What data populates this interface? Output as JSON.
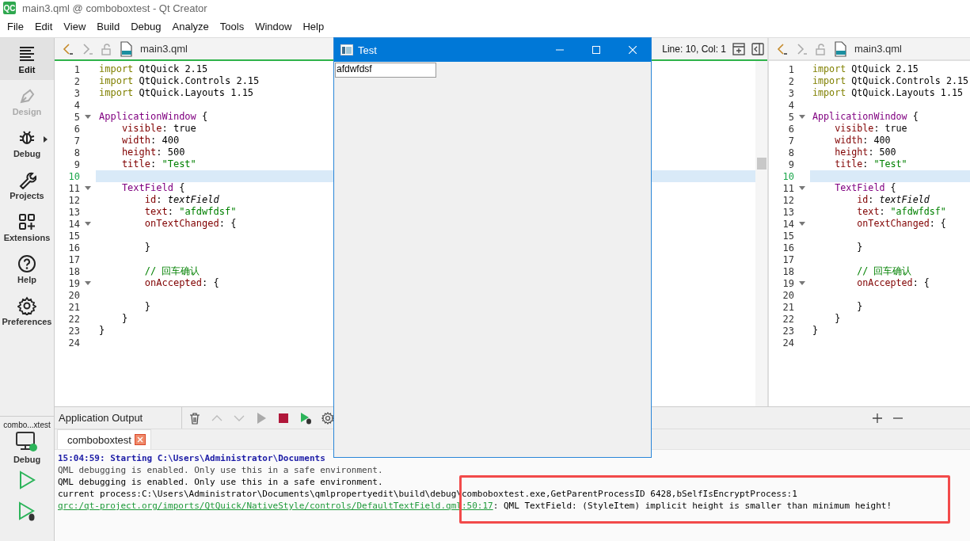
{
  "window": {
    "title": "main3.qml @ comboboxtest - Qt Creator",
    "app_badge": "QC"
  },
  "menu": [
    "File",
    "Edit",
    "View",
    "Build",
    "Debug",
    "Analyze",
    "Tools",
    "Window",
    "Help"
  ],
  "mode_bar": {
    "items": [
      {
        "label": "Edit",
        "kind": "edit",
        "selected": true,
        "disabled": false
      },
      {
        "label": "Design",
        "kind": "design",
        "selected": false,
        "disabled": true
      },
      {
        "label": "Debug",
        "kind": "debug",
        "selected": false,
        "disabled": false
      },
      {
        "label": "Projects",
        "kind": "projects",
        "selected": false,
        "disabled": false
      },
      {
        "label": "Extensions",
        "kind": "extensions",
        "selected": false,
        "disabled": false
      },
      {
        "label": "Help",
        "kind": "help",
        "selected": false,
        "disabled": false
      },
      {
        "label": "Preferences",
        "kind": "preferences",
        "selected": false,
        "disabled": false
      }
    ],
    "kit": {
      "project": "combo...xtest",
      "build": "Debug"
    }
  },
  "editors": [
    {
      "file": "main3.qml",
      "active": true,
      "cursor": "Line: 10, Col: 1",
      "lines": [
        {
          "number": "1",
          "current": false,
          "foldable": false,
          "tokens": [
            {
              "kind": "keyword",
              "text": "import"
            },
            {
              "kind": "plain",
              "text": " QtQuick 2.15"
            }
          ]
        },
        {
          "number": "2",
          "current": false,
          "foldable": false,
          "tokens": [
            {
              "kind": "keyword",
              "text": "import"
            },
            {
              "kind": "plain",
              "text": " QtQuick.Controls 2.15"
            }
          ]
        },
        {
          "number": "3",
          "current": false,
          "foldable": false,
          "tokens": [
            {
              "kind": "keyword",
              "text": "import"
            },
            {
              "kind": "plain",
              "text": " QtQuick.Layouts 1.15"
            }
          ]
        },
        {
          "number": "4",
          "current": false,
          "foldable": false
        },
        {
          "number": "5",
          "current": false,
          "foldable": true,
          "tokens": [
            {
              "kind": "type",
              "text": "ApplicationWindow"
            },
            {
              "kind": "plain",
              "text": " {"
            }
          ]
        },
        {
          "number": "6",
          "current": false,
          "foldable": false,
          "tokens": [
            {
              "kind": "property",
              "text": "visible"
            },
            {
              "kind": "plain",
              "text": ": true"
            }
          ]
        },
        {
          "number": "7",
          "current": false,
          "foldable": false,
          "tokens": [
            {
              "kind": "property",
              "text": "width"
            },
            {
              "kind": "plain",
              "text": ": 400"
            }
          ]
        },
        {
          "number": "8",
          "current": false,
          "foldable": false,
          "tokens": [
            {
              "kind": "property",
              "text": "height"
            },
            {
              "kind": "plain",
              "text": ": 500"
            }
          ]
        },
        {
          "number": "9",
          "current": false,
          "foldable": false,
          "tokens": [
            {
              "kind": "property",
              "text": "title"
            },
            {
              "kind": "plain",
              "text": ": "
            },
            {
              "kind": "string",
              "text": "\"Test\""
            }
          ]
        },
        {
          "number": "10",
          "current": true,
          "foldable": false
        },
        {
          "number": "11",
          "current": false,
          "foldable": true,
          "tokens": [
            {
              "kind": "type",
              "text": "TextField"
            },
            {
              "kind": "plain",
              "text": " {"
            }
          ]
        },
        {
          "number": "12",
          "current": false,
          "foldable": false,
          "tokens": [
            {
              "kind": "property",
              "text": "id"
            },
            {
              "kind": "plain",
              "text": ": "
            },
            {
              "kind": "id",
              "text": "textField"
            }
          ]
        },
        {
          "number": "13",
          "current": false,
          "foldable": false,
          "tokens": [
            {
              "kind": "property",
              "text": "text"
            },
            {
              "kind": "plain",
              "text": ": "
            },
            {
              "kind": "string",
              "text": "\"afdwfdsf\""
            }
          ]
        },
        {
          "number": "14",
          "current": false,
          "foldable": true,
          "tokens": [
            {
              "kind": "property",
              "text": "onTextChanged"
            },
            {
              "kind": "plain",
              "text": ": {"
            }
          ]
        },
        {
          "number": "15",
          "current": false,
          "foldable": false
        },
        {
          "number": "16",
          "current": false,
          "foldable": false,
          "tokens": [
            {
              "kind": "plain",
              "text": "}"
            }
          ]
        },
        {
          "number": "17",
          "current": false,
          "foldable": false
        },
        {
          "number": "18",
          "current": false,
          "foldable": false,
          "tokens": [
            {
              "kind": "comment",
              "text": "// 回车确认"
            }
          ]
        },
        {
          "number": "19",
          "current": false,
          "foldable": true,
          "tokens": [
            {
              "kind": "property",
              "text": "onAccepted"
            },
            {
              "kind": "plain",
              "text": ": {"
            }
          ]
        },
        {
          "number": "20",
          "current": false,
          "foldable": false
        },
        {
          "number": "21",
          "current": false,
          "foldable": false,
          "tokens": [
            {
              "kind": "plain",
              "text": "}"
            }
          ]
        },
        {
          "number": "22",
          "current": false,
          "foldable": false,
          "tokens": [
            {
              "kind": "plain",
              "text": "}"
            }
          ]
        },
        {
          "number": "23",
          "current": false,
          "foldable": false,
          "tokens": [
            {
              "kind": "plain",
              "text": "}"
            }
          ]
        },
        {
          "number": "24",
          "current": false,
          "foldable": false
        }
      ]
    },
    {
      "file": "main3.qml",
      "active": false,
      "lines": [
        {
          "number": "1",
          "current": false,
          "foldable": false,
          "tokens": [
            {
              "kind": "keyword",
              "text": "import"
            },
            {
              "kind": "plain",
              "text": " QtQuick 2.15"
            }
          ]
        },
        {
          "number": "2",
          "current": false,
          "foldable": false,
          "tokens": [
            {
              "kind": "keyword",
              "text": "import"
            },
            {
              "kind": "plain",
              "text": " QtQuick.Controls 2.15"
            }
          ]
        },
        {
          "number": "3",
          "current": false,
          "foldable": false,
          "tokens": [
            {
              "kind": "keyword",
              "text": "import"
            },
            {
              "kind": "plain",
              "text": " QtQuick.Layouts 1.15"
            }
          ]
        },
        {
          "number": "4",
          "current": false,
          "foldable": false
        },
        {
          "number": "5",
          "current": false,
          "foldable": true,
          "tokens": [
            {
              "kind": "type",
              "text": "ApplicationWindow"
            },
            {
              "kind": "plain",
              "text": " {"
            }
          ]
        },
        {
          "number": "6",
          "current": false,
          "foldable": false,
          "tokens": [
            {
              "kind": "property",
              "text": "visible"
            },
            {
              "kind": "plain",
              "text": ": true"
            }
          ]
        },
        {
          "number": "7",
          "current": false,
          "foldable": false,
          "tokens": [
            {
              "kind": "property",
              "text": "width"
            },
            {
              "kind": "plain",
              "text": ": 400"
            }
          ]
        },
        {
          "number": "8",
          "current": false,
          "foldable": false,
          "tokens": [
            {
              "kind": "property",
              "text": "height"
            },
            {
              "kind": "plain",
              "text": ": 500"
            }
          ]
        },
        {
          "number": "9",
          "current": false,
          "foldable": false,
          "tokens": [
            {
              "kind": "property",
              "text": "title"
            },
            {
              "kind": "plain",
              "text": ": "
            },
            {
              "kind": "string",
              "text": "\"Test\""
            }
          ]
        },
        {
          "number": "10",
          "current": true,
          "foldable": false
        },
        {
          "number": "11",
          "current": false,
          "foldable": true,
          "tokens": [
            {
              "kind": "type",
              "text": "TextField"
            },
            {
              "kind": "plain",
              "text": " {"
            }
          ]
        },
        {
          "number": "12",
          "current": false,
          "foldable": false,
          "tokens": [
            {
              "kind": "property",
              "text": "id"
            },
            {
              "kind": "plain",
              "text": ": "
            },
            {
              "kind": "id",
              "text": "textField"
            }
          ]
        },
        {
          "number": "13",
          "current": false,
          "foldable": false,
          "tokens": [
            {
              "kind": "property",
              "text": "text"
            },
            {
              "kind": "plain",
              "text": ": "
            },
            {
              "kind": "string",
              "text": "\"afdwfdsf\""
            }
          ]
        },
        {
          "number": "14",
          "current": false,
          "foldable": true,
          "tokens": [
            {
              "kind": "property",
              "text": "onTextChanged"
            },
            {
              "kind": "plain",
              "text": ": {"
            }
          ]
        },
        {
          "number": "15",
          "current": false,
          "foldable": false
        },
        {
          "number": "16",
          "current": false,
          "foldable": false,
          "tokens": [
            {
              "kind": "plain",
              "text": "}"
            }
          ]
        },
        {
          "number": "17",
          "current": false,
          "foldable": false
        },
        {
          "number": "18",
          "current": false,
          "foldable": false,
          "tokens": [
            {
              "kind": "comment",
              "text": "// 回车确认"
            }
          ]
        },
        {
          "number": "19",
          "current": false,
          "foldable": true,
          "tokens": [
            {
              "kind": "property",
              "text": "onAccepted"
            },
            {
              "kind": "plain",
              "text": ": {"
            }
          ]
        },
        {
          "number": "20",
          "current": false,
          "foldable": false
        },
        {
          "number": "21",
          "current": false,
          "foldable": false,
          "tokens": [
            {
              "kind": "plain",
              "text": "}"
            }
          ]
        },
        {
          "number": "22",
          "current": false,
          "foldable": false,
          "tokens": [
            {
              "kind": "plain",
              "text": "}"
            }
          ]
        },
        {
          "number": "23",
          "current": false,
          "foldable": false,
          "tokens": [
            {
              "kind": "plain",
              "text": "}"
            }
          ]
        },
        {
          "number": "24",
          "current": false,
          "foldable": false
        }
      ]
    }
  ],
  "output_pane": {
    "title": "Application Output",
    "tabs": [
      {
        "label": "comboboxtest",
        "selected": true
      }
    ],
    "lines": [
      {
        "tokens": [
          {
            "kind": "start",
            "text": "15:04:59: Starting C:\\Users\\Administrator\\Documents"
          }
        ]
      },
      {
        "tokens": [
          {
            "kind": "debug",
            "text": "QML debugging is enabled. Only use this in a safe environment."
          }
        ]
      },
      {
        "tokens": [
          {
            "kind": "stdout",
            "text": "QML debugging is enabled. Only use this in a safe environment."
          }
        ]
      },
      {
        "tokens": [
          {
            "kind": "stdout",
            "text": "current process:C:\\Users\\Administrator\\Documents\\qmlpropertyedit\\build\\debug\\comboboxtest.exe,GetParentProcessID 6428,bSelfIsEncryptProcess:1"
          }
        ]
      },
      {
        "tokens": [
          {
            "kind": "link",
            "text": "qrc:/qt-project.org/imports/QtQuick/NativeStyle/controls/DefaultTextField.qml:50:17"
          },
          {
            "kind": "stdout",
            "text": ": QML TextField: (StyleItem) implicit height is smaller than minimum height!"
          }
        ]
      }
    ]
  },
  "app_window": {
    "title": "Test",
    "text_field": {
      "value": "afdwfdsf"
    }
  }
}
